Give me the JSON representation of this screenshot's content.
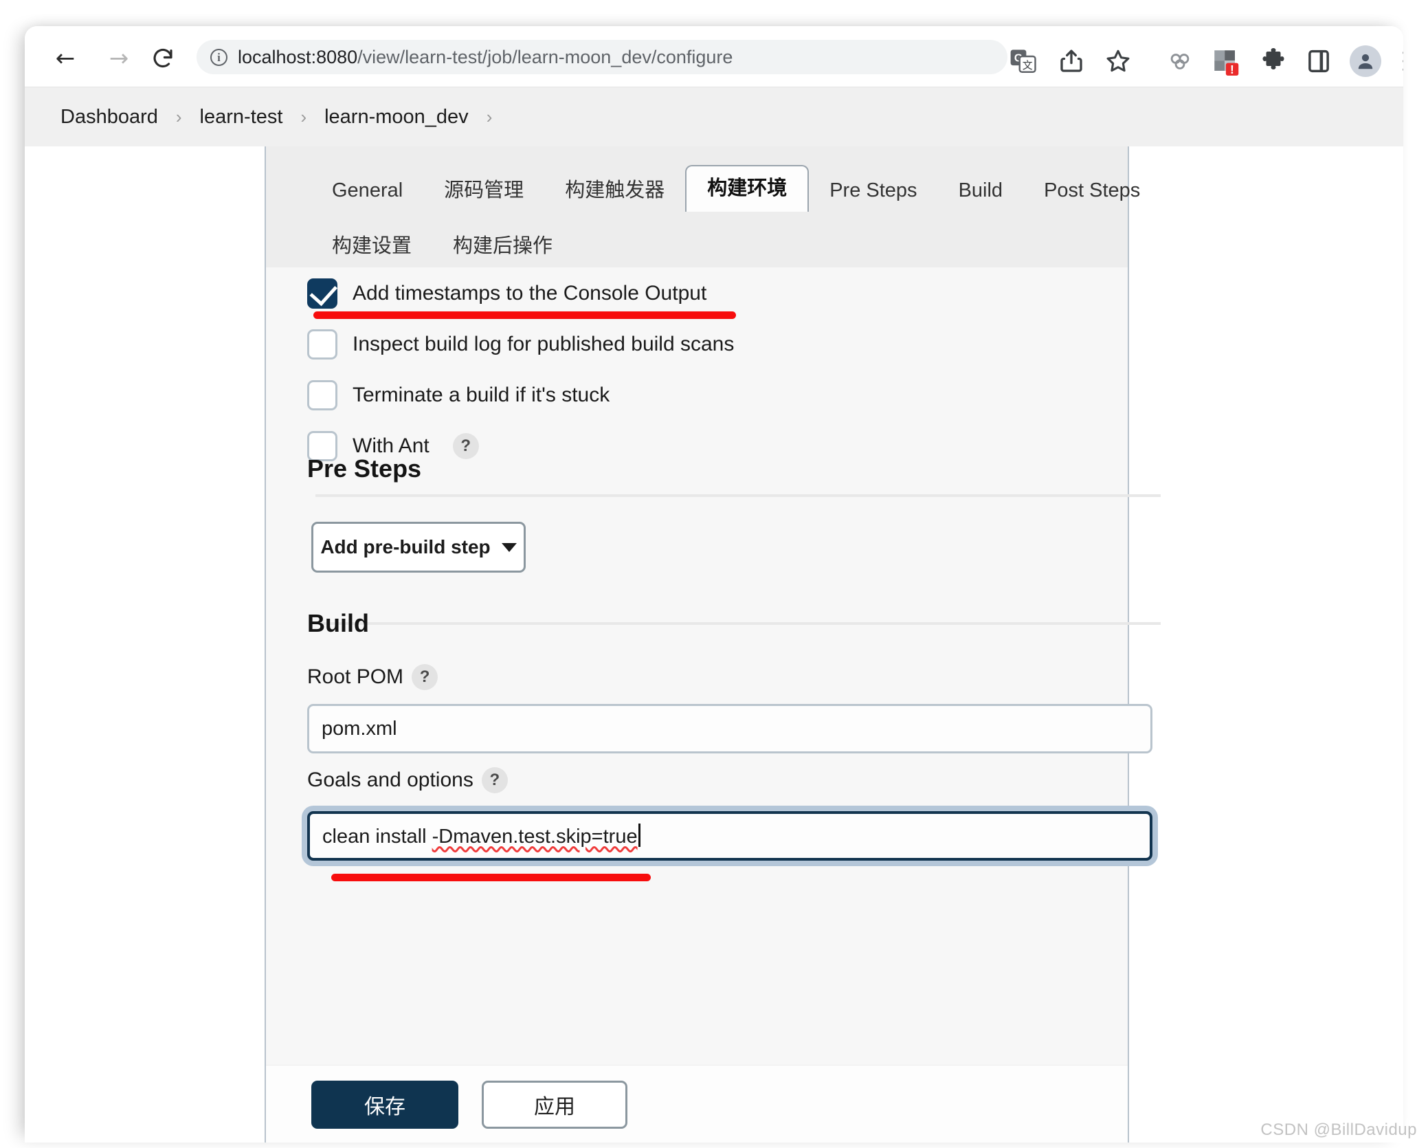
{
  "browser": {
    "url_host": "localhost:8080",
    "url_path": "/view/learn-test/job/learn-moon_dev/configure",
    "back_label": "←",
    "forward_label": "→",
    "reload_label": "↻",
    "icons": {
      "info": "i",
      "translate": "translate-icon",
      "share": "share-icon",
      "star": "star-icon",
      "link": "link-icon",
      "extension_color": "extension-color-icon",
      "extension_badge": "!",
      "puzzle": "puzzle-icon",
      "side_panel": "side-panel-icon",
      "avatar": "avatar-icon",
      "menu": "three-dot-menu-icon"
    }
  },
  "breadcrumb": {
    "items": [
      {
        "label": "Dashboard"
      },
      {
        "label": "learn-test"
      },
      {
        "label": "learn-moon_dev"
      }
    ],
    "separator": "›"
  },
  "tabs": {
    "row1": [
      {
        "label": "General",
        "active": false
      },
      {
        "label": "源码管理",
        "active": false
      },
      {
        "label": "构建触发器",
        "active": false
      },
      {
        "label": "构建环境",
        "active": true
      },
      {
        "label": "Pre Steps",
        "active": false
      },
      {
        "label": "Build",
        "active": false
      },
      {
        "label": "Post Steps",
        "active": false
      }
    ],
    "row2": [
      {
        "label": "构建设置",
        "active": false
      },
      {
        "label": "构建后操作",
        "active": false
      }
    ]
  },
  "build_environment": {
    "checkboxes": [
      {
        "label": "Add timestamps to the Console Output",
        "checked": true,
        "help": false
      },
      {
        "label": "Inspect build log for published build scans",
        "checked": false,
        "help": false
      },
      {
        "label": "Terminate a build if it's stuck",
        "checked": false,
        "help": false
      },
      {
        "label": "With Ant",
        "checked": false,
        "help": true,
        "help_label": "?"
      }
    ]
  },
  "pre_steps": {
    "title": "Pre Steps",
    "add_button": "Add pre-build step",
    "caret": "▾"
  },
  "build": {
    "title": "Build",
    "root_pom": {
      "label": "Root POM",
      "help_label": "?",
      "value": "pom.xml"
    },
    "goals_and_options": {
      "label": "Goals and options",
      "help_label": "?",
      "value_plain": "clean install ",
      "value_misspelled": "-Dmaven.test.skip=true",
      "full_value": "clean install -Dmaven.test.skip=true"
    }
  },
  "actions": {
    "save_label": "保存",
    "apply_label": "应用"
  },
  "annotations": {
    "color": "#f70d0d",
    "marks": 2
  },
  "watermark": "CSDN @BillDavidup"
}
